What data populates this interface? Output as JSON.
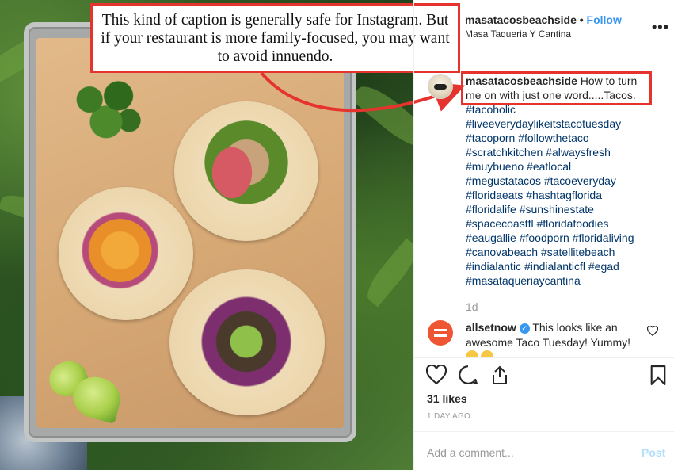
{
  "annotation": {
    "text": "This kind of caption is generally safe for Instagram. But if your restaurant is more family-focused, you may want to avoid innuendo.",
    "accent_color": "#e5332e"
  },
  "header": {
    "username": "masatacosbeachside",
    "separator": "•",
    "follow_label": "Follow",
    "location": "Masa Taqueria Y Cantina",
    "more_icon": "more-options-icon"
  },
  "caption": {
    "username": "masatacosbeachside",
    "text": "How to turn me on with just one word.....Tacos.",
    "hashtags": [
      "#tacoholic",
      "#liveeverydaylikeitstacotuesday",
      "#tacoporn #followthetaco",
      "#scratchkitchen #alwaysfresh",
      "#muybueno #eatlocal",
      "#megustatacos #tacoeveryday",
      "#floridaeats #hashtagflorida",
      "#floridalife #sunshinestate",
      "#spacecoastfl #floridafoodies",
      "#eaugallie #foodporn #floridaliving",
      "#canovabeach #satellitebeach",
      "#indialantic #indialanticfl #egad",
      "#masataqueriaycantina"
    ],
    "age": "1d"
  },
  "comment": {
    "username": "allsetnow",
    "text": "This looks like an awesome Taco Tuesday! Yummy!"
  },
  "actions": {
    "icons": [
      "heart-icon",
      "comment-icon",
      "share-icon",
      "bookmark-icon"
    ]
  },
  "likes": "31 likes",
  "posted": "1 DAY AGO",
  "add_comment": {
    "placeholder": "Add a comment...",
    "post_label": "Post"
  },
  "colors": {
    "link": "#3897f0",
    "hashtag": "#003569",
    "muted": "#999999",
    "post_disabled": "#b2dffc"
  }
}
